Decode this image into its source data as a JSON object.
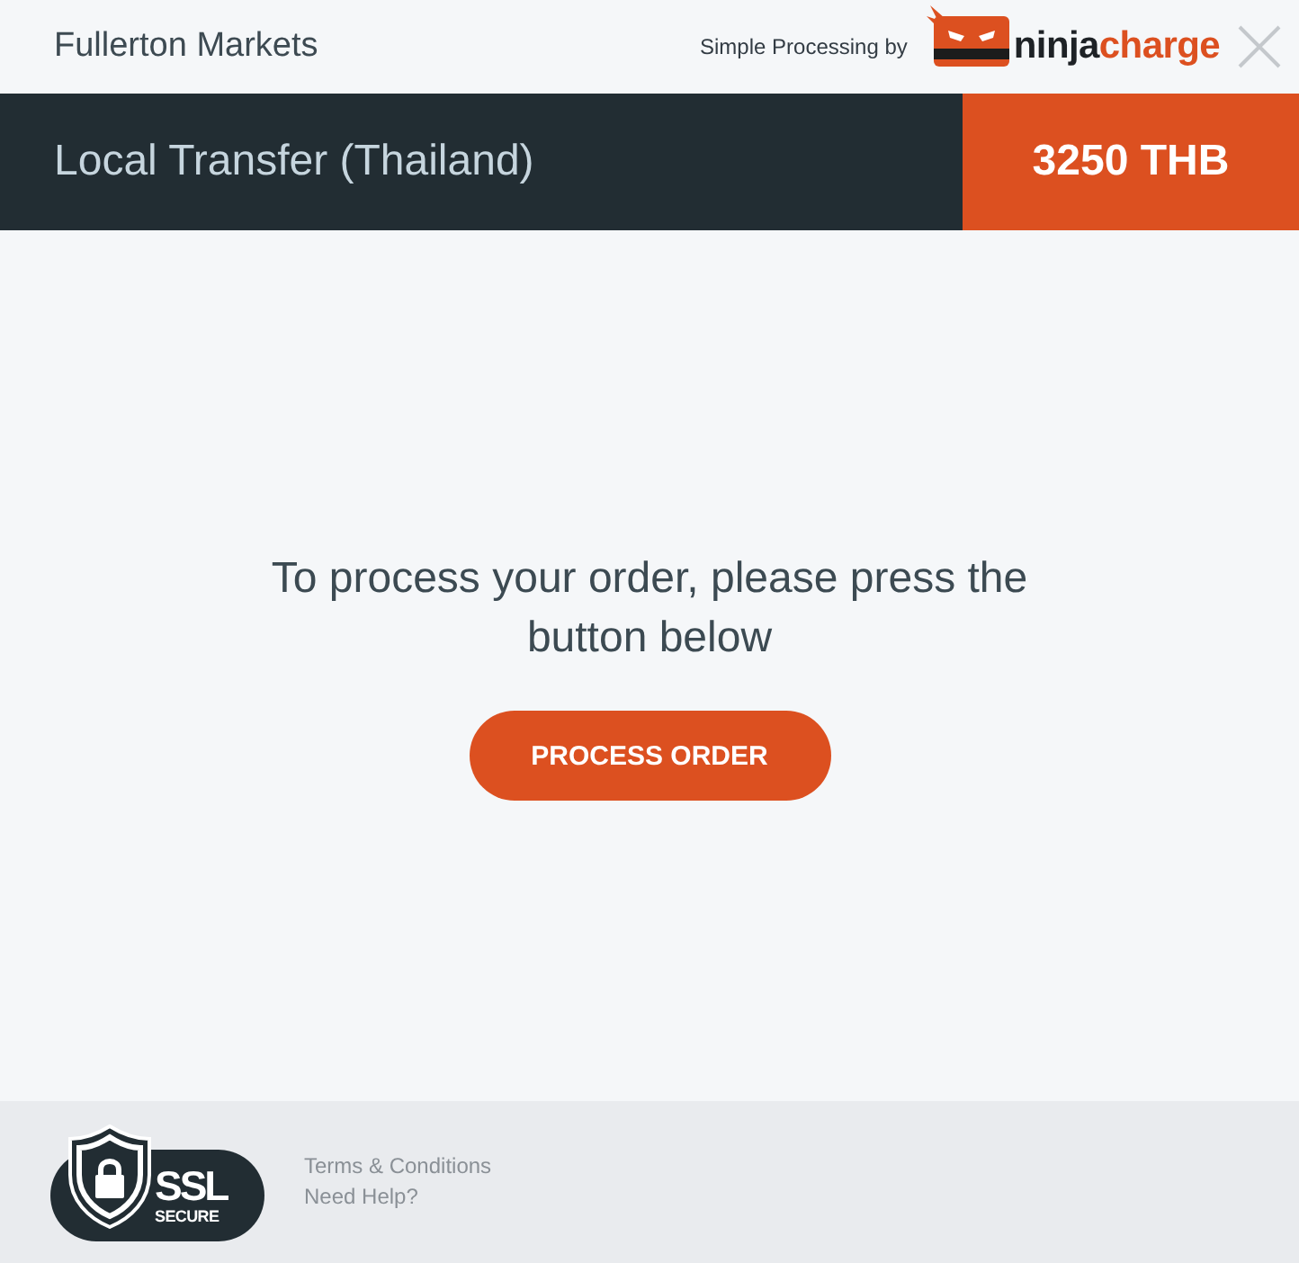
{
  "header": {
    "merchant": "Fullerton Markets",
    "powered_by": "Simple Processing by",
    "brand": {
      "first": "ninja",
      "second": "charge"
    }
  },
  "payment_bar": {
    "method": "Local Transfer (Thailand)",
    "amount": "3250 THB"
  },
  "body": {
    "message": "To process your order, please press the button below",
    "button": "PROCESS ORDER"
  },
  "footer": {
    "badge": {
      "main": "SSL",
      "sub": "SECURE"
    },
    "links": [
      "Terms & Conditions",
      "Need Help?"
    ]
  }
}
